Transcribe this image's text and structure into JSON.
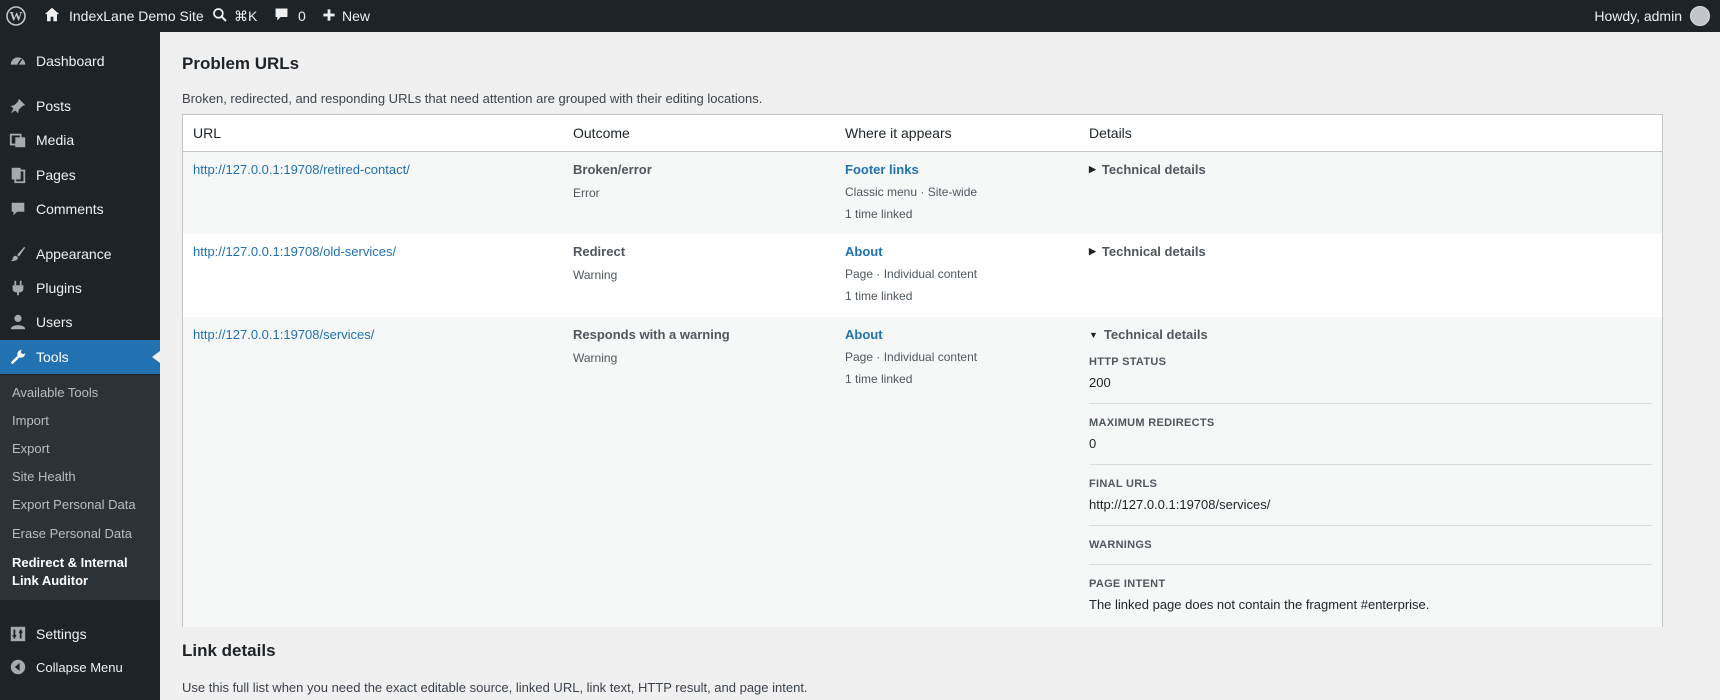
{
  "adminbar": {
    "site_name": "IndexLane Demo Site",
    "search_shortcut": "⌘K",
    "comments_count": "0",
    "new_label": "New",
    "howdy": "Howdy, admin"
  },
  "sidebar": {
    "items": [
      {
        "label": "Dashboard",
        "icon": "dashboard-icon"
      },
      {
        "label": "Posts",
        "icon": "pushpin-icon"
      },
      {
        "label": "Media",
        "icon": "media-icon"
      },
      {
        "label": "Pages",
        "icon": "pages-icon"
      },
      {
        "label": "Comments",
        "icon": "comment-icon"
      },
      {
        "label": "Appearance",
        "icon": "brush-icon"
      },
      {
        "label": "Plugins",
        "icon": "plug-icon"
      },
      {
        "label": "Users",
        "icon": "user-icon"
      },
      {
        "label": "Tools",
        "icon": "wrench-icon"
      },
      {
        "label": "Settings",
        "icon": "settings-icon"
      },
      {
        "label": "Collapse Menu",
        "icon": "collapse-icon"
      }
    ],
    "submenu": [
      "Available Tools",
      "Import",
      "Export",
      "Site Health",
      "Export Personal Data",
      "Erase Personal Data",
      "Redirect & Internal Link Auditor"
    ]
  },
  "problem_urls": {
    "title": "Problem URLs",
    "description": "Broken, redirected, and responding URLs that need attention are grouped with their editing locations.",
    "columns": [
      "URL",
      "Outcome",
      "Where it appears",
      "Details"
    ],
    "rows": [
      {
        "url": "http://127.0.0.1:19708/retired-contact/",
        "outcome": "Broken/error",
        "severity": "Error",
        "where_link": "Footer links",
        "where_meta": "Classic menu · Site-wide",
        "times": "1 time linked",
        "details_label": "Technical details"
      },
      {
        "url": "http://127.0.0.1:19708/old-services/",
        "outcome": "Redirect",
        "severity": "Warning",
        "where_link": "About",
        "where_meta": "Page · Individual content",
        "times": "1 time linked",
        "details_label": "Technical details"
      },
      {
        "url": "http://127.0.0.1:19708/services/",
        "outcome": "Responds with a warning",
        "severity": "Warning",
        "where_link": "About",
        "where_meta": "Page · Individual content",
        "times": "1 time linked",
        "details_label": "Technical details",
        "details": [
          {
            "label": "HTTP STATUS",
            "value": "200"
          },
          {
            "label": "MAXIMUM REDIRECTS",
            "value": "0"
          },
          {
            "label": "FINAL URLS",
            "value": "http://127.0.0.1:19708/services/"
          },
          {
            "label": "WARNINGS",
            "value": ""
          },
          {
            "label": "PAGE INTENT",
            "value": "The linked page does not contain the fragment #enterprise."
          }
        ]
      }
    ]
  },
  "link_details": {
    "title": "Link details",
    "description": "Use this full list when you need the exact editable source, linked URL, link text, HTTP result, and page intent."
  }
}
